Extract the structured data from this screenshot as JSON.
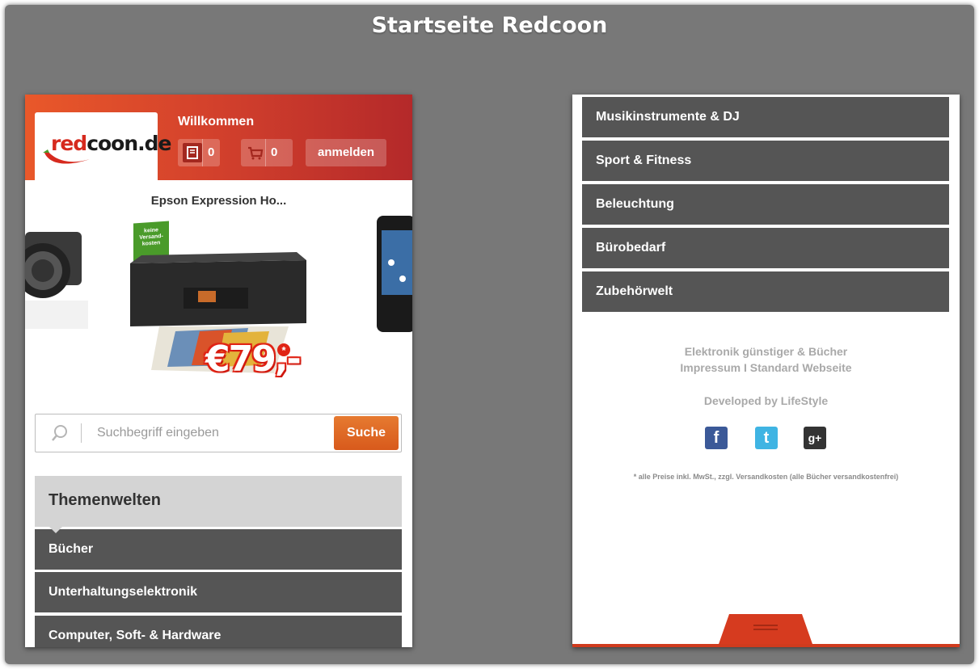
{
  "page_title": "Startseite Redcoon",
  "left_screen": {
    "logo_text_red": "red",
    "logo_text_dark": "coon.de",
    "welcome": "Willkommen",
    "notes_count": "0",
    "cart_count": "0",
    "login_label": "anmelden",
    "product_title": "Epson Expression Ho...",
    "badge_text": "keine Versand- kosten",
    "price": "€79,-",
    "price_star": "*",
    "search_placeholder": "Suchbegriff eingeben",
    "search_button": "Suche",
    "section_title": "Themenwelten",
    "categories": [
      {
        "label": "Bücher"
      },
      {
        "label": "Unterhaltungselektronik"
      },
      {
        "label": "Computer, Soft- & Hardware"
      }
    ]
  },
  "right_screen": {
    "categories": [
      {
        "label": "Musikinstrumente & DJ"
      },
      {
        "label": "Sport & Fitness"
      },
      {
        "label": "Beleuchtung"
      },
      {
        "label": "Bürobedarf"
      },
      {
        "label": "Zubehörwelt"
      }
    ],
    "footer_line1": "Elektronik günstiger & Bücher",
    "footer_line2": "Impressum I Standard Webseite",
    "developed_by": "Developed by LifeStyle",
    "social": {
      "facebook": "f",
      "twitter": "t",
      "google": "g+"
    },
    "legal": "* alle Preise inkl. MwSt., zzgl. Versandkosten (alle Bücher versandkostenfrei)"
  },
  "colors": {
    "header_orange": "#e9582a",
    "header_red": "#b4292a",
    "category_bg": "#555555",
    "search_button": "#e06a24",
    "frame_gray": "#787878"
  }
}
